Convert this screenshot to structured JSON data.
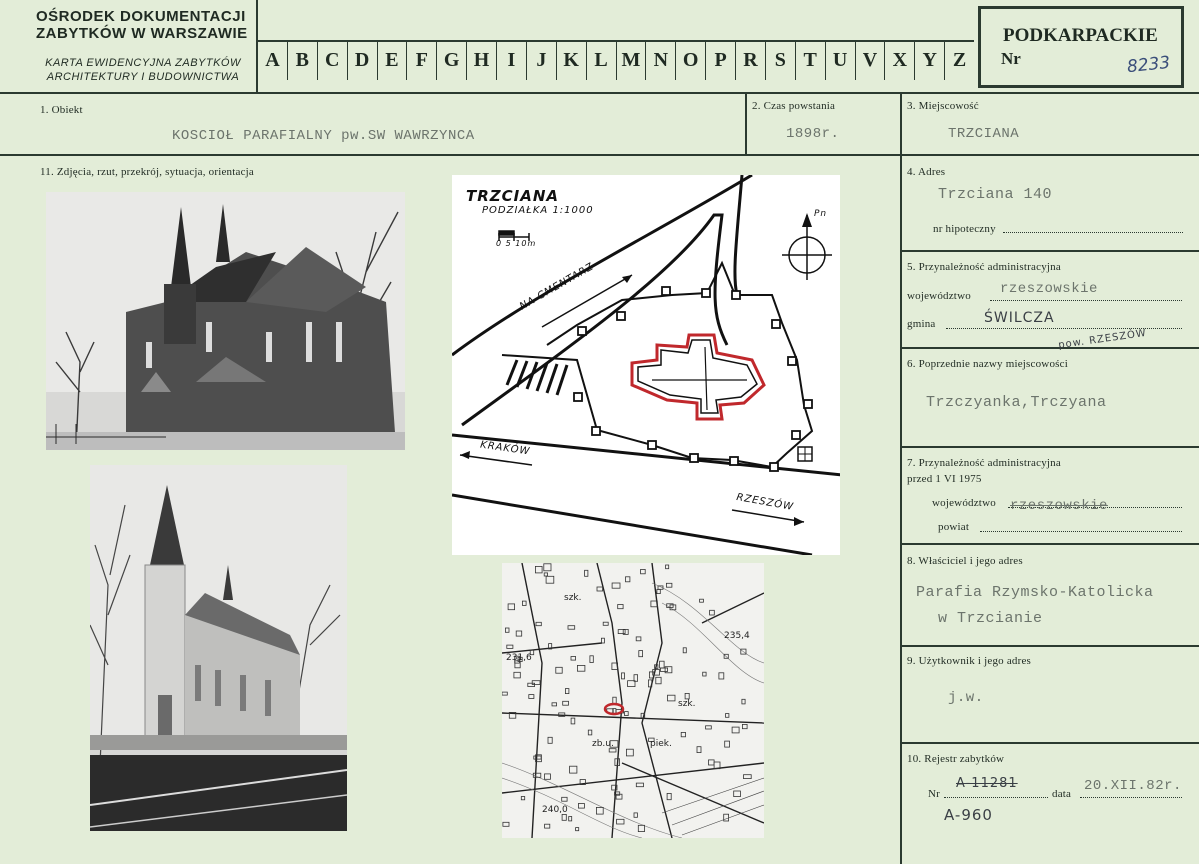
{
  "header": {
    "org_line1": "OŚRODEK DOKUMENTACJI",
    "org_line2": "ZABYTKÓW W WARSZAWIE",
    "karta_line1": "KARTA EWIDENCYJNA ZABYTKÓW",
    "karta_line2": "ARCHITEKTURY I BUDOWNICTWA",
    "letters": [
      "A",
      "B",
      "C",
      "D",
      "E",
      "F",
      "G",
      "H",
      "I",
      "J",
      "K",
      "L",
      "M",
      "N",
      "O",
      "P",
      "R",
      "S",
      "T",
      "U",
      "V",
      "X",
      "Y",
      "Z"
    ],
    "region": "PODKARPACKIE",
    "nr_label": "Nr",
    "nr_value": "8233"
  },
  "fields": {
    "obiekt_label": "1. Obiekt",
    "obiekt_value": "KOSCIOŁ PARAFIALNY pw.SW WAWRZYNCA",
    "czas_label": "2. Czas powstania",
    "czas_value": "1898r.",
    "miejscowosc_label": "3. Miejscowość",
    "miejscowosc_value": "TRZCIANA",
    "zdjecia_label": "11. Zdjęcia, rzut, przekrój, sytuacja, orientacja",
    "adres_label": "4. Adres",
    "adres_value": "Trzciana 140",
    "hipoteczny_label": "nr hipoteczny",
    "przyn_label": "5. Przynależność administracyjna",
    "woj_label": "województwo",
    "woj_value": "rzeszowskie",
    "gmina_label": "gmina",
    "gmina_value": "ŚWILCZA",
    "gmina_note": "pow. RZESZÓW",
    "poprz_label": "6. Poprzednie nazwy miejscowości",
    "poprz_value": "Trzczyanka,Trczyana",
    "przyn75_label": "7. Przynależność administracyjna",
    "przyn75_label2": "przed 1 VI 1975",
    "woj75_label": "województwo",
    "woj75_value": "rzeszowskie",
    "powiat_label": "powiat",
    "wlasciciel_label": "8. Właściciel i jego adres",
    "wlasciciel_line1": "Parafia Rzymsko-Katolicka",
    "wlasciciel_line2": "w Trzcianie",
    "uzytkownik_label": "9. Użytkownik i jego adres",
    "uzytkownik_value": "j.w.",
    "rejestr_label": "10. Rejestr zabytków",
    "rejestr_nr_label": "Nr",
    "rejestr_nr_struck": "A-11281",
    "rejestr_nr_new": "A-960",
    "data_label": "data",
    "data_value": "20.XII.82r."
  },
  "sketch": {
    "title": "TRZCIANA",
    "scale": "PODZIAŁKA 1:1000",
    "scale_ticks": "0  5  10m",
    "north": "Pn",
    "road1": "NA CMENTARZ",
    "road2": "KRAKÓW",
    "road3": "RZESZÓW"
  },
  "topo": {
    "labels": [
      "szk.",
      "235,4",
      "231,6",
      "szk.",
      "zb.u.",
      "piek.",
      "240,0"
    ]
  },
  "colors": {
    "card": "#e3edd8",
    "ink": "#2b3a30",
    "red_outline": "#c0282c"
  }
}
